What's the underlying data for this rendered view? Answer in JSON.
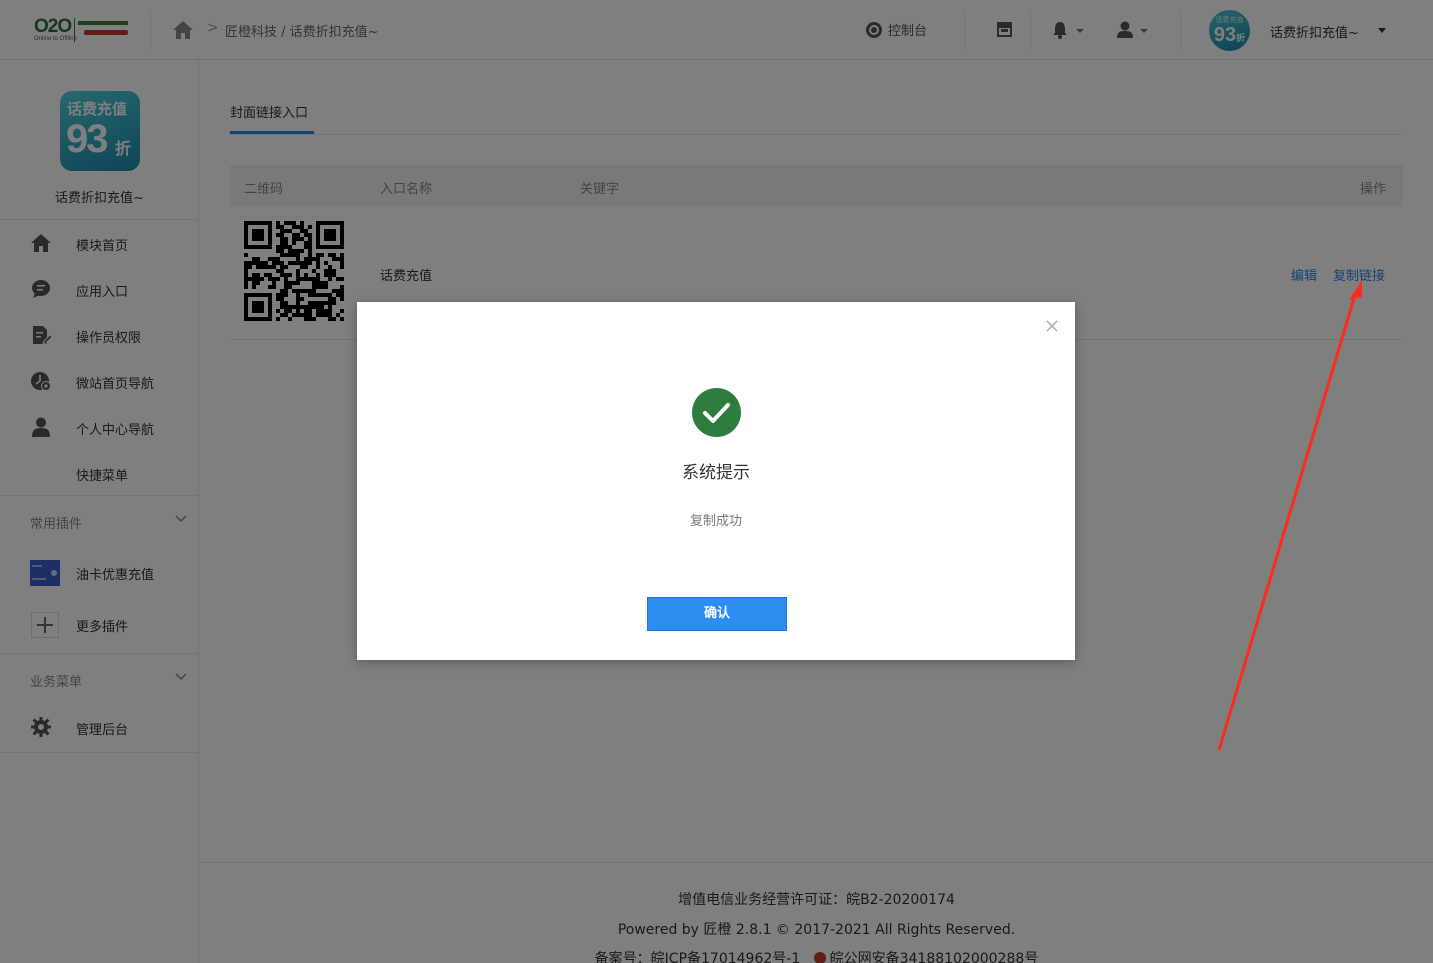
{
  "header": {
    "logo_text": "O2O",
    "logo_sub": "Online to Offline",
    "breadcrumb": "匠橙科技 / 话费折扣充值~",
    "console_label": "控制台",
    "avatar_top": "话费充值",
    "avatar_num": "93",
    "avatar_suffix": "折",
    "shop_name": "话费折扣充值~"
  },
  "sidebar": {
    "app_logo_title": "话费充值",
    "app_logo_number": "93",
    "app_logo_suffix": "折",
    "app_name": "话费折扣充值~",
    "items": [
      {
        "label": "模块首页",
        "icon": "home-icon"
      },
      {
        "label": "应用入口",
        "icon": "chat-bubble-icon"
      },
      {
        "label": "操作员权限",
        "icon": "edit-document-icon"
      },
      {
        "label": "微站首页导航",
        "icon": "clock-user-icon"
      },
      {
        "label": "个人中心导航",
        "icon": "user-icon"
      },
      {
        "label": "快捷菜单",
        "icon": ""
      }
    ],
    "group_plugins": "常用插件",
    "plugins": [
      {
        "label": "油卡优惠充值",
        "icon": "fuel-card-icon"
      },
      {
        "label": "更多插件",
        "icon": "plus-icon"
      }
    ],
    "group_business": "业务菜单",
    "business": [
      {
        "label": "管理后台",
        "icon": "gear-icon"
      }
    ]
  },
  "main": {
    "tab": "封面链接入口",
    "columns": [
      "二维码",
      "入口名称",
      "关键字",
      "操作"
    ],
    "rows": [
      {
        "name": "话费充值",
        "keyword": "",
        "actions": [
          "编辑",
          "复制链接"
        ]
      }
    ]
  },
  "footer": {
    "line1": "增值电信业务经营许可证：皖B2-20200174",
    "line2": "Powered by 匠橙 2.8.1 © 2017-2021 All Rights Reserved.",
    "line3a": "备案号：皖ICP备17014962号-1",
    "line3b": "皖公网安备34188102000288号"
  },
  "modal": {
    "title": "系统提示",
    "message": "复制成功",
    "confirm": "确认"
  },
  "colors": {
    "accent": "#2d8cf0",
    "success": "#2f7d3e",
    "annotation_arrow": "#ff2a1a"
  }
}
